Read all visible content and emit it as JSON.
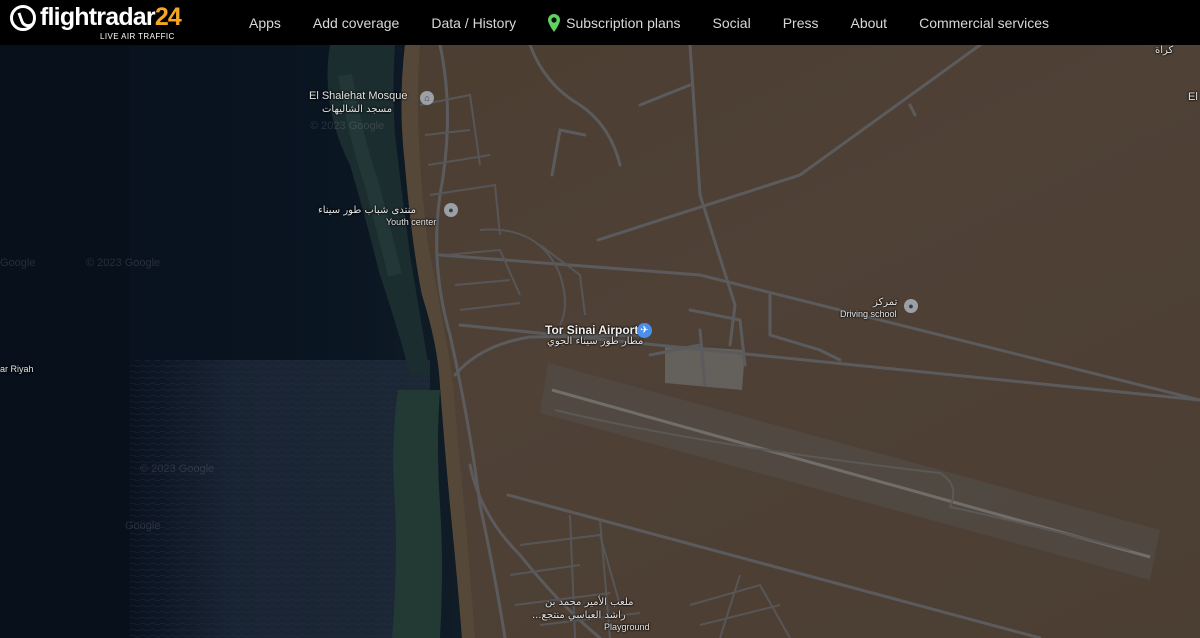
{
  "header": {
    "logo_text": "flightradar",
    "logo_number": "24",
    "logo_tagline": "LIVE AIR TRAFFIC",
    "nav": [
      {
        "label": "Apps"
      },
      {
        "label": "Add coverage"
      },
      {
        "label": "Data / History"
      },
      {
        "label": "Subscription plans",
        "icon": "location-pin-icon"
      },
      {
        "label": "Social"
      },
      {
        "label": "Press"
      },
      {
        "label": "About"
      },
      {
        "label": "Commercial services"
      }
    ]
  },
  "map": {
    "labels": {
      "mosque_en": "El Shalehat Mosque",
      "mosque_ar": "مسجد الشاليهات",
      "youth_ar": "منتدى شباب طور سيناء",
      "youth_en": "Youth center",
      "airport_en": "Tor Sinai Airport",
      "airport_ar": "مطار طور سيناء الجوي",
      "driving_ar": "تمركز",
      "driving_en": "Driving school",
      "riyah": "ar Riyah",
      "playground_ar_1": "ملعب الأمير محمد بن",
      "playground_ar_2": "راشد العباسي منتجع...",
      "playground_en": "Playground",
      "watermark_1": "© 2023 Google",
      "watermark_2": "Google",
      "watermark_3": "© 2023 Google",
      "watermark_4": "© 2023 Google",
      "watermark_5": "Google",
      "edge_ar": "كراة",
      "edge_en": "El"
    },
    "icons": {
      "airport": "airplane-icon",
      "mosque": "mosque-icon",
      "poi": "map-pin-icon"
    },
    "colors": {
      "sea_deep": "#0b1626",
      "sea_shallow": "#1c2a35",
      "reef": "#27413a",
      "desert": "#5e4d3d",
      "road": "#6e6e70",
      "road_outline": "#3a3a3c"
    }
  }
}
